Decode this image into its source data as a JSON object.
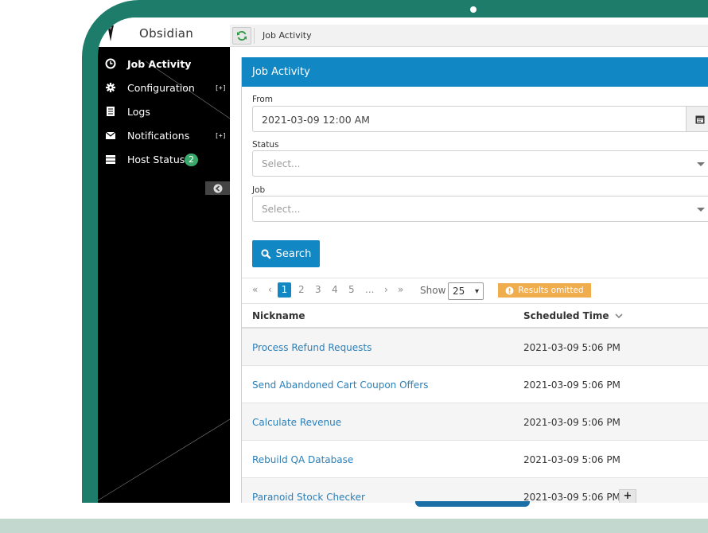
{
  "app": {
    "name": "Obsidian"
  },
  "breadcrumb": {
    "current": "Job Activity"
  },
  "sidebar": {
    "items": [
      {
        "label": "Job Activity",
        "icon": "clock-icon",
        "active": true
      },
      {
        "label": "Configuration",
        "icon": "gear-icon",
        "expand": "[+]"
      },
      {
        "label": "Logs",
        "icon": "document-icon"
      },
      {
        "label": "Notifications",
        "icon": "envelope-icon",
        "expand": "[+]"
      },
      {
        "label": "Host Status",
        "icon": "server-icon",
        "badge": "2"
      }
    ]
  },
  "panel": {
    "title": "Job Activity"
  },
  "form": {
    "from_label": "From",
    "from_value": "2021-03-09 12:00 AM",
    "status_label": "Status",
    "status_placeholder": "Select...",
    "job_label": "Job",
    "job_placeholder": "Select...",
    "search_label": "Search"
  },
  "pager": {
    "first": "«",
    "prev": "‹",
    "pages": [
      "1",
      "2",
      "3",
      "4",
      "5",
      "..."
    ],
    "next": "›",
    "last": "»",
    "current": "1",
    "show_label": "Show",
    "page_size": "25",
    "omitted_label": "Results omitted"
  },
  "table": {
    "columns": [
      "Nickname",
      "Scheduled Time"
    ],
    "rows": [
      {
        "nickname": "Process Refund Requests",
        "time": "2021-03-09 5:06 PM"
      },
      {
        "nickname": "Send Abandoned Cart Coupon Offers",
        "time": "2021-03-09 5:06 PM"
      },
      {
        "nickname": "Calculate Revenue",
        "time": "2021-03-09 5:06 PM"
      },
      {
        "nickname": "Rebuild QA Database",
        "time": "2021-03-09 5:06 PM"
      },
      {
        "nickname": "Paranoid Stock Checker",
        "time": "2021-03-09 5:06 PM",
        "expand": "+"
      }
    ]
  },
  "colors": {
    "accent": "#1188c4",
    "frame": "#1e7d6a",
    "warning": "#f0ad4e",
    "badge": "#3aa86b",
    "link": "#2a7fb8"
  }
}
